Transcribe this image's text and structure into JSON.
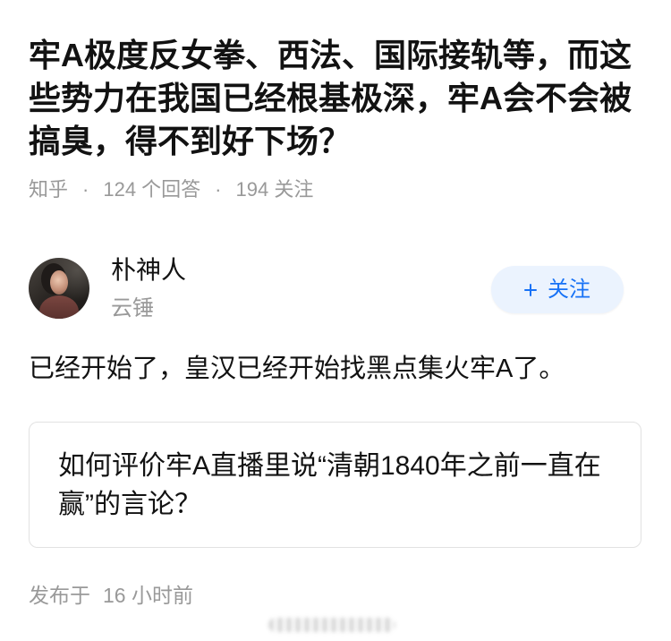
{
  "question": {
    "title": "牢A极度反女拳、西法、国际接轨等，而这些势力在我国已经根基极深，牢A会不会被搞臭，得不到好下场？",
    "source": "知乎",
    "separator": "·",
    "answer_count": "124 个回答",
    "follower_count": "194 关注"
  },
  "author": {
    "name": "朴神人",
    "headline": "云锤",
    "follow_label": "关注",
    "follow_icon": "plus-icon"
  },
  "answer": {
    "text": "已经开始了，皇汉已经开始找黑点集火牢A了。",
    "linked_question": "如何评价牢A直播里说“清朝1840年之前一直在赢”的言论？",
    "publish_label": "发布于",
    "publish_time": "16 小时前"
  },
  "colors": {
    "text": "#121212",
    "muted": "#999999",
    "accent": "#1772f6",
    "button_bg": "#ebf3fe",
    "card_border": "#e2e2e2"
  }
}
